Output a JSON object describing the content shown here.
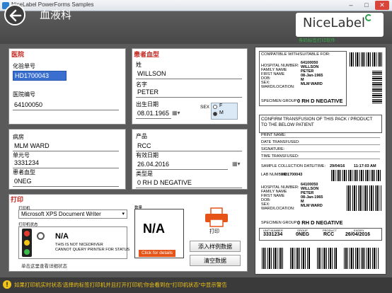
{
  "window": {
    "title": "NiceLabel PowerForms Samples",
    "minimize": "–",
    "maximize": "□",
    "close": "✕"
  },
  "header": {
    "title": "血液科",
    "logo_text": "NiceLabel",
    "logo_sub": "条码标签打印软件"
  },
  "hospital": {
    "section_title": "医院",
    "lab_no_label": "化验单号",
    "lab_no_value": "HD1700043",
    "hospital_no_label": "医院编号",
    "hospital_no_value": "64100050"
  },
  "patient": {
    "section_title": "患者血型",
    "surname_label": "姓",
    "surname_value": "WILLSON",
    "name_label": "名字",
    "name_value": "PETER",
    "dob_label": "出生日期",
    "dob_value": "08.01.1965",
    "sex_label": "SEX",
    "sex_f": "F",
    "sex_m": "M"
  },
  "ward": {
    "ward_label": "病房",
    "ward_value": "MLM WARD",
    "unit_label": "单元号",
    "unit_value": "3331234",
    "blood_label": "患者血型",
    "blood_value": "0NEG"
  },
  "product": {
    "product_label": "产品",
    "product_value": "RCC",
    "expiry_label": "有效日期",
    "expiry_value": "26.04.2016",
    "type_label": "类型是",
    "type_value": "0 RH D NEGATIVE"
  },
  "print": {
    "section_title": "打印",
    "printer_label": "打印机",
    "printer_value": "Microsoft XPS Document Writer",
    "status_label": "打印机状态",
    "status_code": "N/A",
    "status_line1": "THIS IS NOT NICEDRIVER",
    "status_line2": "CANNOT QUERY PRINTER FOR STATUS",
    "status_hint": "单击这里查看详细状态",
    "qty_label": "数量",
    "qty_value": "N/A",
    "details_link": "Click for details",
    "print_button": "打印",
    "sample_button": "添入样例数据",
    "clear_button": "清空数据"
  },
  "label_preview": {
    "top_title": "COMPATIBLE WITH/SUITABLE FOR:",
    "top_fields": [
      {
        "k": "HOSPITAL NUMBER:",
        "v": "64100050"
      },
      {
        "k": "FAMILY NAME",
        "v": "WILLSON"
      },
      {
        "k": "FIRST NAME",
        "v": "PETER"
      },
      {
        "k": "DOB:",
        "v": "08-Jan-1965"
      },
      {
        "k": "SEX:",
        "v": "M"
      },
      {
        "k": "WARD/LOCATION:",
        "v": "MLM WARD"
      }
    ],
    "specimen_group_label": "SPECIMEN GROUP:",
    "specimen_group_value": "0 RH D NEGATIVE",
    "confirm_line1": "CONFIRM TRANSFUSION OF THIS PACK / PRODUCT",
    "confirm_line2": "TO THE BELOW PATIENT",
    "print_name": "PRINT NAME:",
    "date_transfused": "DATE TRANSFUSED:",
    "signature": "SIGNATURE:",
    "time_transfused": "TIME TRANSFUSED:",
    "sample_collection_label": "SAMPLE COLLECTION DATE/TIME:",
    "sample_collection_date": "29/04/16",
    "sample_collection_time": "11:17:03 AM",
    "lab_number_label": "LAB NUMBER:",
    "lab_number_value": "HD1700043",
    "bottom_fields": [
      {
        "k": "HOSPITAL NUMBER:",
        "v": "64100050"
      },
      {
        "k": "FAMILY NAME",
        "v": "WILLSON"
      },
      {
        "k": "FIRST NAME",
        "v": "PETER"
      },
      {
        "k": "DOB:",
        "v": "08-Jan-1965"
      },
      {
        "k": "SEX:",
        "v": "M"
      },
      {
        "k": "WARD/LOCATION:",
        "v": "MLM WARD"
      }
    ],
    "specimen_group_label2": "SPECIMEN GROUP:",
    "specimen_group_value2": "0 RH D NEGATIVE",
    "unit_cap": "UNIT NUMBER",
    "unit_val": "3331234",
    "group_cap": "GROUP",
    "group_val": "0NEG",
    "product_cap": "PRODUCT",
    "product_val": "RCC",
    "expiry_cap": "EXPIRY",
    "expiry_val": "26/04/2016"
  },
  "status_bar": {
    "text": "如果打印机实时状态‘选择的标签打印机并且打开打印机’你会看到在“打印机状态”中显示警告"
  }
}
